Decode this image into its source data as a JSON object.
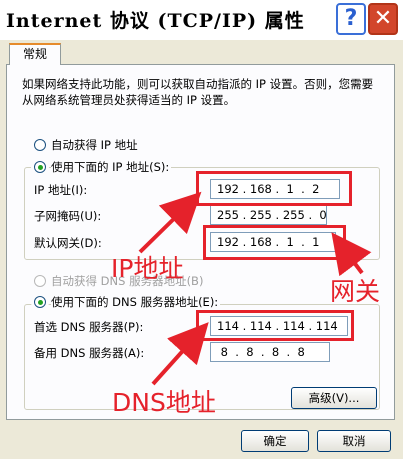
{
  "window": {
    "title": "Internet 协议 (TCP/IP) 属性",
    "help_label": "?",
    "close_label": "✕"
  },
  "tab": {
    "label": "常规"
  },
  "description": "如果网络支持此功能，则可以获取自动指派的 IP 设置。否则，您需要从网络系统管理员处获得适当的 IP 设置。",
  "ip_section": {
    "auto_label": "自动获得 IP 地址",
    "manual_label": "使用下面的 IP 地址(S):",
    "ip_label": "IP 地址(I):",
    "ip_value": "192 . 168 .  1  .  2",
    "mask_label": "子网掩码(U):",
    "mask_value": "255 . 255 . 255 .  0",
    "gateway_label": "默认网关(D):",
    "gateway_value": "192 . 168 .  1  .  1"
  },
  "dns_section": {
    "auto_label": "自动获得 DNS 服务器地址(B)",
    "manual_label": "使用下面的 DNS 服务器地址(E):",
    "preferred_label": "首选 DNS 服务器(P):",
    "preferred_value": "114 . 114 . 114 . 114",
    "alternate_label": "备用 DNS 服务器(A):",
    "alternate_value": " 8  .  8  .  8  .  8"
  },
  "buttons": {
    "advanced": "高级(V)...",
    "ok": "确定",
    "cancel": "取消"
  },
  "annotations": {
    "ip": "IP地址",
    "gateway": "网关",
    "dns": "DNS地址"
  },
  "colors": {
    "annotation": "#e5222b",
    "dialog_bg": "#ece9d8",
    "panel_bg": "#fcfcfe"
  }
}
